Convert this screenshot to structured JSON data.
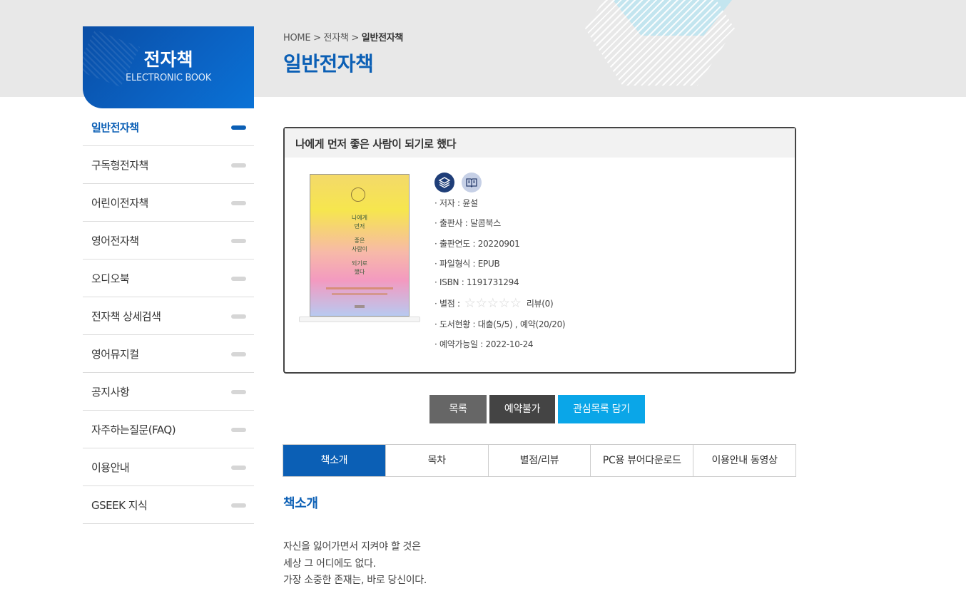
{
  "sidebar": {
    "title": "전자책",
    "subtitle": "ELECTRONIC BOOK",
    "items": [
      {
        "label": "일반전자책"
      },
      {
        "label": "구독형전자책"
      },
      {
        "label": "어린이전자책"
      },
      {
        "label": "영어전자책"
      },
      {
        "label": "오디오북"
      },
      {
        "label": "전자책 상세검색"
      },
      {
        "label": "영어뮤지컬"
      },
      {
        "label": "공지사항"
      },
      {
        "label": "자주하는질문(FAQ)"
      },
      {
        "label": "이용안내"
      },
      {
        "label": "GSEEK 지식"
      }
    ],
    "active_index": 0
  },
  "breadcrumb": {
    "home": "HOME",
    "sep": ">",
    "level1": "전자책",
    "current": "일반전자책"
  },
  "page_title": "일반전자책",
  "book": {
    "title": "나에게 먼저 좋은 사람이 되기로 했다",
    "cover": {
      "line1": "나에게",
      "line2": "먼저",
      "line3": "좋은",
      "line4": "사람이",
      "line5": "되기로",
      "line6": "했다"
    },
    "info": {
      "author": "· 저자 : 윤설",
      "publisher": "· 출판사 : 달콤북스",
      "year": "· 출판연도 : 20220901",
      "format": "· 파일형식 : EPUB",
      "isbn": "· ISBN : 1191731294",
      "rating_label": "· 별점 :",
      "review": "리뷰(0)",
      "status": "· 도서현황 : 대출(5/5) , 예약(20/20)",
      "reserve_date": "· 예약가능일 : 2022-10-24"
    },
    "rating": 0
  },
  "buttons": {
    "list": "목록",
    "reserve": "예약불가",
    "wishlist": "관심목록 담기"
  },
  "tabs": [
    "책소개",
    "목차",
    "별점/리뷰",
    "PC용 뷰어다운로드",
    "이용안내 동영상"
  ],
  "section_title": "책소개",
  "intro_lines": [
    "자신을 잃어가면서 지켜야 할 것은",
    "세상 그 어디에도 없다.",
    "가장 소중한 존재는, 바로 당신이다."
  ],
  "colors": {
    "brand": "#0b5fb5",
    "wish": "#0aa6e8"
  }
}
